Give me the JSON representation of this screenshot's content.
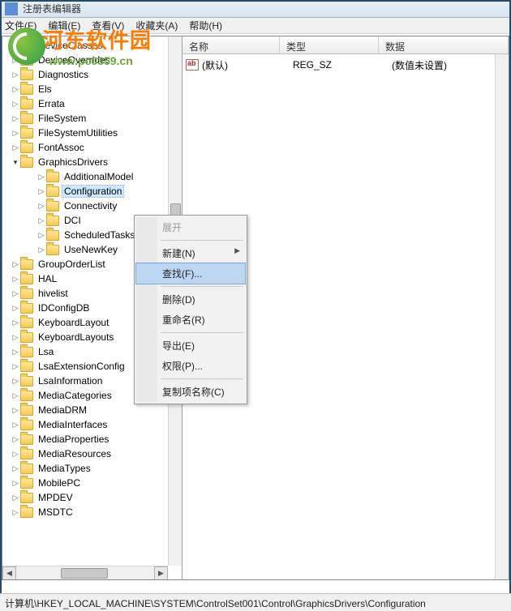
{
  "title": "注册表编辑器",
  "watermark": {
    "text": "河东软件园",
    "sub": "www.pc0359.cn"
  },
  "menu": {
    "file": "文件(F)",
    "edit": "编辑(E)",
    "view": "查看(V)",
    "fav": "收藏夹(A)",
    "help": "帮助(H)"
  },
  "columns": {
    "name": "名称",
    "type": "类型",
    "data": "数据"
  },
  "value_row": {
    "name": "(默认)",
    "type": "REG_SZ",
    "data": "(数值未设置)"
  },
  "tree": {
    "items": [
      "DeviceClasses",
      "DeviceOverrides",
      "Diagnostics",
      "Els",
      "Errata",
      "FileSystem",
      "FileSystemUtilities",
      "FontAssoc"
    ],
    "gd": "GraphicsDrivers",
    "gd_children": [
      "AdditionalModel",
      "Configuration",
      "Connectivity",
      "DCI",
      "ScheduledTasks",
      "UseNewKey"
    ],
    "rest": [
      "GroupOrderList",
      "HAL",
      "hivelist",
      "IDConfigDB",
      "KeyboardLayout",
      "KeyboardLayouts",
      "Lsa",
      "LsaExtensionConfig",
      "LsaInformation",
      "MediaCategories",
      "MediaDRM",
      "MediaInterfaces",
      "MediaProperties",
      "MediaResources",
      "MediaTypes",
      "MobilePC",
      "MPDEV",
      "MSDTC"
    ]
  },
  "ctx": {
    "expand": "展开",
    "new": "新建(N)",
    "find": "查找(F)...",
    "del": "删除(D)",
    "ren": "重命名(R)",
    "exp": "导出(E)",
    "perm": "权限(P)...",
    "copy": "复制项名称(C)"
  },
  "status": "计算机\\HKEY_LOCAL_MACHINE\\SYSTEM\\ControlSet001\\Control\\GraphicsDrivers\\Configuration"
}
